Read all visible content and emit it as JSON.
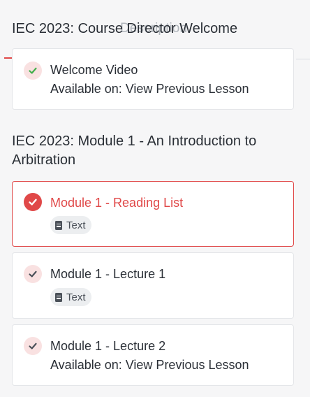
{
  "tabs": {
    "ghost_label": "Description"
  },
  "sections": [
    {
      "title": "IEC 2023: Course Director Welcome",
      "items": [
        {
          "title": "Welcome Video",
          "availability": "Available on: View Previous Lesson",
          "status": "completed"
        }
      ]
    },
    {
      "title": "IEC 2023: Module 1 - An Introduction to Arbitration",
      "items": [
        {
          "title": "Module 1 - Reading List",
          "badge": "Text",
          "status": "active-completed"
        },
        {
          "title": "Module 1 - Lecture 1",
          "badge": "Text",
          "status": "completed"
        },
        {
          "title": "Module 1 - Lecture 2",
          "availability": "Available on: View Previous Lesson",
          "status": "completed"
        }
      ]
    }
  ],
  "colors": {
    "accent": "#e04848",
    "check_green": "#3fae49",
    "check_gray": "#4a5058",
    "check_bg": "#f9e1e1"
  },
  "icons": {
    "check": "check-icon",
    "document": "document-icon"
  }
}
